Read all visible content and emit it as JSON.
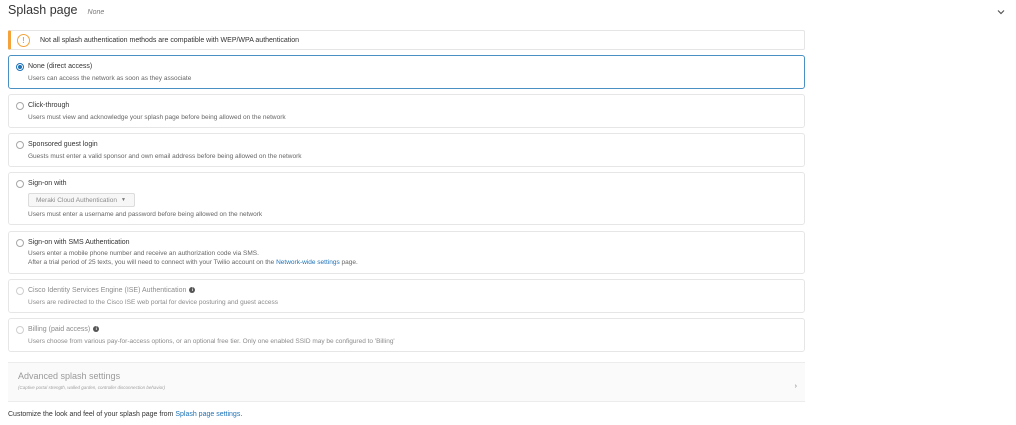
{
  "header": {
    "title": "Splash page",
    "value": "None"
  },
  "warning": {
    "icon": "warning-icon",
    "text": "Not all splash authentication methods are compatible with WEP/WPA authentication"
  },
  "options": [
    {
      "title": "None (direct access)",
      "desc": "Users can access the network as soon as they associate",
      "checked": true
    },
    {
      "title": "Click-through",
      "desc": "Users must view and acknowledge your splash page before being allowed on the network"
    },
    {
      "title": "Sponsored guest login",
      "desc": "Guests must enter a valid sponsor and own email address before being allowed on the network"
    },
    {
      "title": "Sign-on with",
      "select": "Meraki Cloud Authentication",
      "desc": "Users must enter a username and password before being allowed on the network"
    },
    {
      "title": "Sign-on with SMS Authentication",
      "desc": "Users enter a mobile phone number and receive an authorization code via SMS.",
      "desc2_prefix": "After a trial period of 25 texts, you will need to connect with your Twilio account on the",
      "desc2_link": "Network-wide settings",
      "desc2_suffix": "page."
    },
    {
      "title": "Cisco Identity Services Engine (ISE) Authentication",
      "desc": "Users are redirected to the Cisco ISE web portal for device posturing and guest access",
      "disabled": true
    },
    {
      "title": "Billing (paid access)",
      "desc": "Users choose from various pay-for-access options, or an optional free tier. Only one enabled SSID may be configured to 'Billing'",
      "disabled": true
    }
  ],
  "advanced": {
    "title": "Advanced splash settings",
    "subtitle": "(Captive portal strength, walled garden, controller disconnection behavior)"
  },
  "footer": {
    "prefix": "Customize the look and feel of your splash page from",
    "link": "Splash page settings",
    "suffix": "."
  }
}
